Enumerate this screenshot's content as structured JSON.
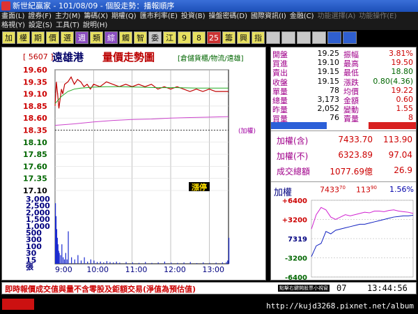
{
  "window": {
    "title": "新世紀贏家 - 101/08/09 - 個股走勢：播報順序"
  },
  "menu": {
    "row1": [
      "畫面(L)",
      "證券(F)",
      "主力(M)",
      "籌碼(X)",
      "期權(Q)",
      "匯市利率(E)",
      "投資(B)",
      "操盤密碼(D)",
      "國際資訊(I)",
      "金融(C)",
      "功能選擇(A)",
      "功能操作(E)"
    ],
    "row2": [
      "格視(Y)",
      "設定(S)",
      "工具(T)",
      "說明(H)"
    ]
  },
  "toolbar": [
    {
      "label": "加",
      "style": "yellow"
    },
    {
      "label": "權",
      "style": "yellow"
    },
    {
      "label": "期",
      "style": "yellow"
    },
    {
      "label": "價",
      "style": "yellow"
    },
    {
      "label": "選",
      "style": "yellow"
    },
    {
      "label": "週",
      "style": "purple"
    },
    {
      "label": "類",
      "style": "yellow"
    },
    {
      "label": "綜",
      "style": "purple"
    },
    {
      "label": "觸",
      "style": "yellow"
    },
    {
      "label": "智",
      "style": "yellow"
    },
    {
      "label": "委",
      "style": "gray"
    },
    {
      "label": "江",
      "style": "yellow"
    },
    {
      "label": "9",
      "style": "yellow"
    },
    {
      "label": "8",
      "style": "yellow"
    },
    {
      "label": "25",
      "style": "red"
    },
    {
      "label": "籌",
      "style": "yellow"
    },
    {
      "label": "興",
      "style": "yellow"
    },
    {
      "label": "指",
      "style": "yellow"
    },
    {
      "label": "",
      "style": "gray"
    },
    {
      "label": "",
      "style": "gray"
    },
    {
      "label": "",
      "style": "gray"
    },
    {
      "label": "",
      "style": "gray"
    },
    {
      "label": "",
      "style": "blue"
    },
    {
      "label": "",
      "style": "blue"
    }
  ],
  "stock": {
    "code": "[ 5607 ]",
    "name": "遠雄港",
    "chart_name": "量價走勢圖",
    "industry": "[倉儲貨櫃/物流/遠雄]"
  },
  "quote": [
    {
      "l1": "開盤",
      "v1": "19.25",
      "c1": "#000",
      "l2": "振幅",
      "v2": "3.81%",
      "c2": "#c00"
    },
    {
      "l1": "買進",
      "v1": "19.10",
      "c1": "#000",
      "l2": "最高",
      "v2": "19.50",
      "c2": "#c00"
    },
    {
      "l1": "賣出",
      "v1": "19.15",
      "c1": "#000",
      "l2": "最低",
      "v2": "18.80",
      "c2": "#060"
    },
    {
      "l1": "收盤",
      "v1": "19.15",
      "c1": "#000",
      "l2": "漲跌",
      "v2": "0.80(4.36)",
      "c2": "#060"
    },
    {
      "l1": "單量",
      "v1": "78",
      "c1": "#000",
      "l2": "均價",
      "v2": "19.22",
      "c2": "#c00"
    },
    {
      "l1": "總量",
      "v1": "3,173",
      "c1": "#000",
      "l2": "金額",
      "v2": "0.60",
      "c2": "#c00"
    },
    {
      "l1": "昨量",
      "v1": "2,052",
      "c1": "#000",
      "l2": "變動",
      "v2": "1.55",
      "c2": "#c00"
    },
    {
      "l1": "買量",
      "v1": "76",
      "c1": "#000",
      "l2": "賣量",
      "v2": "8",
      "c2": "#c00"
    }
  ],
  "index": {
    "taiex_incl_label": "加權(含)",
    "taiex_incl_value": "7433.70",
    "taiex_incl_change": "113.90",
    "taiex_excl_label": "加權(不)",
    "taiex_excl_value": "6323.89",
    "taiex_excl_change": "97.04",
    "turnover_label": "成交總額",
    "turnover_value": "1077.69億",
    "turnover_change": "26.9"
  },
  "mini_chart": {
    "title": "加權",
    "value": "7433",
    "value_frac": "70",
    "change": "113",
    "change_frac": "90",
    "pct": "1.56%",
    "yticks": [
      "+6400",
      "+3200",
      "7319",
      "-3200",
      "-6400"
    ],
    "ytick_values": [
      6400,
      3200,
      0,
      -3200,
      -6400
    ],
    "baseline_tick": "7319",
    "series": [
      {
        "name": "",
        "color": "#d020d0",
        "values": [
          1600,
          4000,
          5200,
          4800,
          3600,
          3200,
          3600,
          4000,
          3800,
          4000,
          4200,
          4400,
          4300,
          4600,
          4600,
          4500,
          4700,
          4800,
          4600,
          4500,
          4400,
          4200
        ]
      },
      {
        "name": "",
        "color": "#1020c0",
        "values": [
          -3000,
          -1200,
          -800,
          1200,
          800,
          1400,
          1600,
          1800,
          2000,
          2200,
          2400,
          2400,
          2600,
          2800,
          3000,
          3200,
          3400,
          3600,
          3700,
          3800,
          3800,
          3900
        ]
      }
    ]
  },
  "status": {
    "text": "即時報價成交值與量不含零股及鉅額交易(淨值為預估值)",
    "tiny": "點擊右鍵開股票小視窗",
    "step": "07",
    "clock": "13:44:56"
  },
  "watermark": "http://kujd3268.pixnet.net/album",
  "chart_data": {
    "type": "line",
    "title": "量價走勢圖",
    "xlabel": "",
    "ylabel": "",
    "x_ticks": [
      "9:00",
      "10:00",
      "11:00",
      "12:00",
      "13:00"
    ],
    "price_ticks": [
      "19.60",
      "19.35",
      "19.10",
      "18.85",
      "18.60",
      "18.35",
      "18.10",
      "17.85",
      "17.60",
      "17.35",
      "17.10"
    ],
    "price_tick_values": [
      19.6,
      19.35,
      19.1,
      18.85,
      18.6,
      18.35,
      18.1,
      17.85,
      17.6,
      17.35,
      17.1
    ],
    "price_colors": [
      "#c00",
      "#c00",
      "#c00",
      "#c00",
      "#c00",
      "#c00",
      "#060",
      "#060",
      "#060",
      "#060",
      "#000"
    ],
    "ylim_price": [
      17.1,
      19.6
    ],
    "ylim_volume": [
      0,
      3000
    ],
    "volume_ticks": [
      "3,000",
      "2,500",
      "2,000",
      "1,500",
      "1,000",
      "500",
      "300",
      "100",
      "30",
      "15",
      "張"
    ],
    "reference_price": 18.35,
    "limit_up_label": "漲停",
    "avg_label": "(加權)",
    "series": [
      {
        "name": "",
        "color": "#c00000",
        "x": [
          0,
          2,
          4,
          6,
          8,
          10,
          12,
          15,
          20,
          25,
          30,
          35,
          40,
          45,
          50,
          55,
          60,
          70,
          80,
          90,
          100,
          110,
          120,
          130,
          140,
          150,
          160,
          170,
          180,
          190,
          200,
          210,
          220,
          230,
          240,
          250,
          260,
          270
        ],
        "values": [
          18.85,
          19.35,
          19.1,
          18.8,
          19.0,
          19.2,
          19.1,
          19.3,
          19.35,
          19.45,
          19.3,
          19.4,
          19.35,
          19.25,
          19.3,
          19.2,
          19.3,
          19.25,
          19.35,
          19.3,
          19.25,
          19.3,
          19.25,
          19.3,
          19.25,
          19.3,
          19.2,
          19.25,
          19.2,
          19.25,
          19.2,
          19.15,
          19.2,
          19.15,
          19.2,
          19.15,
          19.15,
          19.15
        ]
      },
      {
        "name": "",
        "color": "#22aa22",
        "x": [
          0,
          10,
          20,
          30,
          40,
          60,
          80,
          100,
          130,
          160,
          190,
          220,
          250,
          270
        ],
        "values": [
          18.9,
          19.05,
          19.15,
          19.2,
          19.22,
          19.24,
          19.25,
          19.25,
          19.24,
          19.23,
          19.23,
          19.22,
          19.22,
          19.22
        ]
      },
      {
        "name": "",
        "color": "#cc44cc",
        "x": [
          0,
          30,
          60,
          90,
          120,
          150,
          180,
          210,
          240,
          270
        ],
        "values": [
          18.45,
          18.48,
          18.52,
          18.55,
          18.57,
          18.58,
          18.6,
          18.61,
          18.62,
          18.63
        ]
      }
    ],
    "volume_x": [
      0,
      1,
      2,
      3,
      4,
      5,
      6,
      8,
      10,
      12,
      14,
      16,
      18,
      20,
      25,
      30,
      35,
      40,
      45,
      50,
      55,
      60,
      65,
      70,
      75,
      80,
      85,
      90,
      95,
      100,
      110,
      120,
      130,
      140,
      150,
      160,
      170,
      180,
      190,
      200,
      210,
      220,
      230,
      240,
      250,
      260,
      266,
      268,
      270
    ],
    "volume": [
      2800,
      2200,
      1600,
      1200,
      900,
      600,
      500,
      400,
      900,
      300,
      200,
      500,
      200,
      1500,
      300,
      200,
      400,
      150,
      300,
      100,
      200,
      150,
      80,
      100,
      60,
      120,
      80,
      60,
      100,
      50,
      80,
      60,
      40,
      80,
      40,
      60,
      100,
      50,
      40,
      60,
      80,
      30,
      60,
      40,
      50,
      60,
      80,
      150,
      1200
    ]
  }
}
